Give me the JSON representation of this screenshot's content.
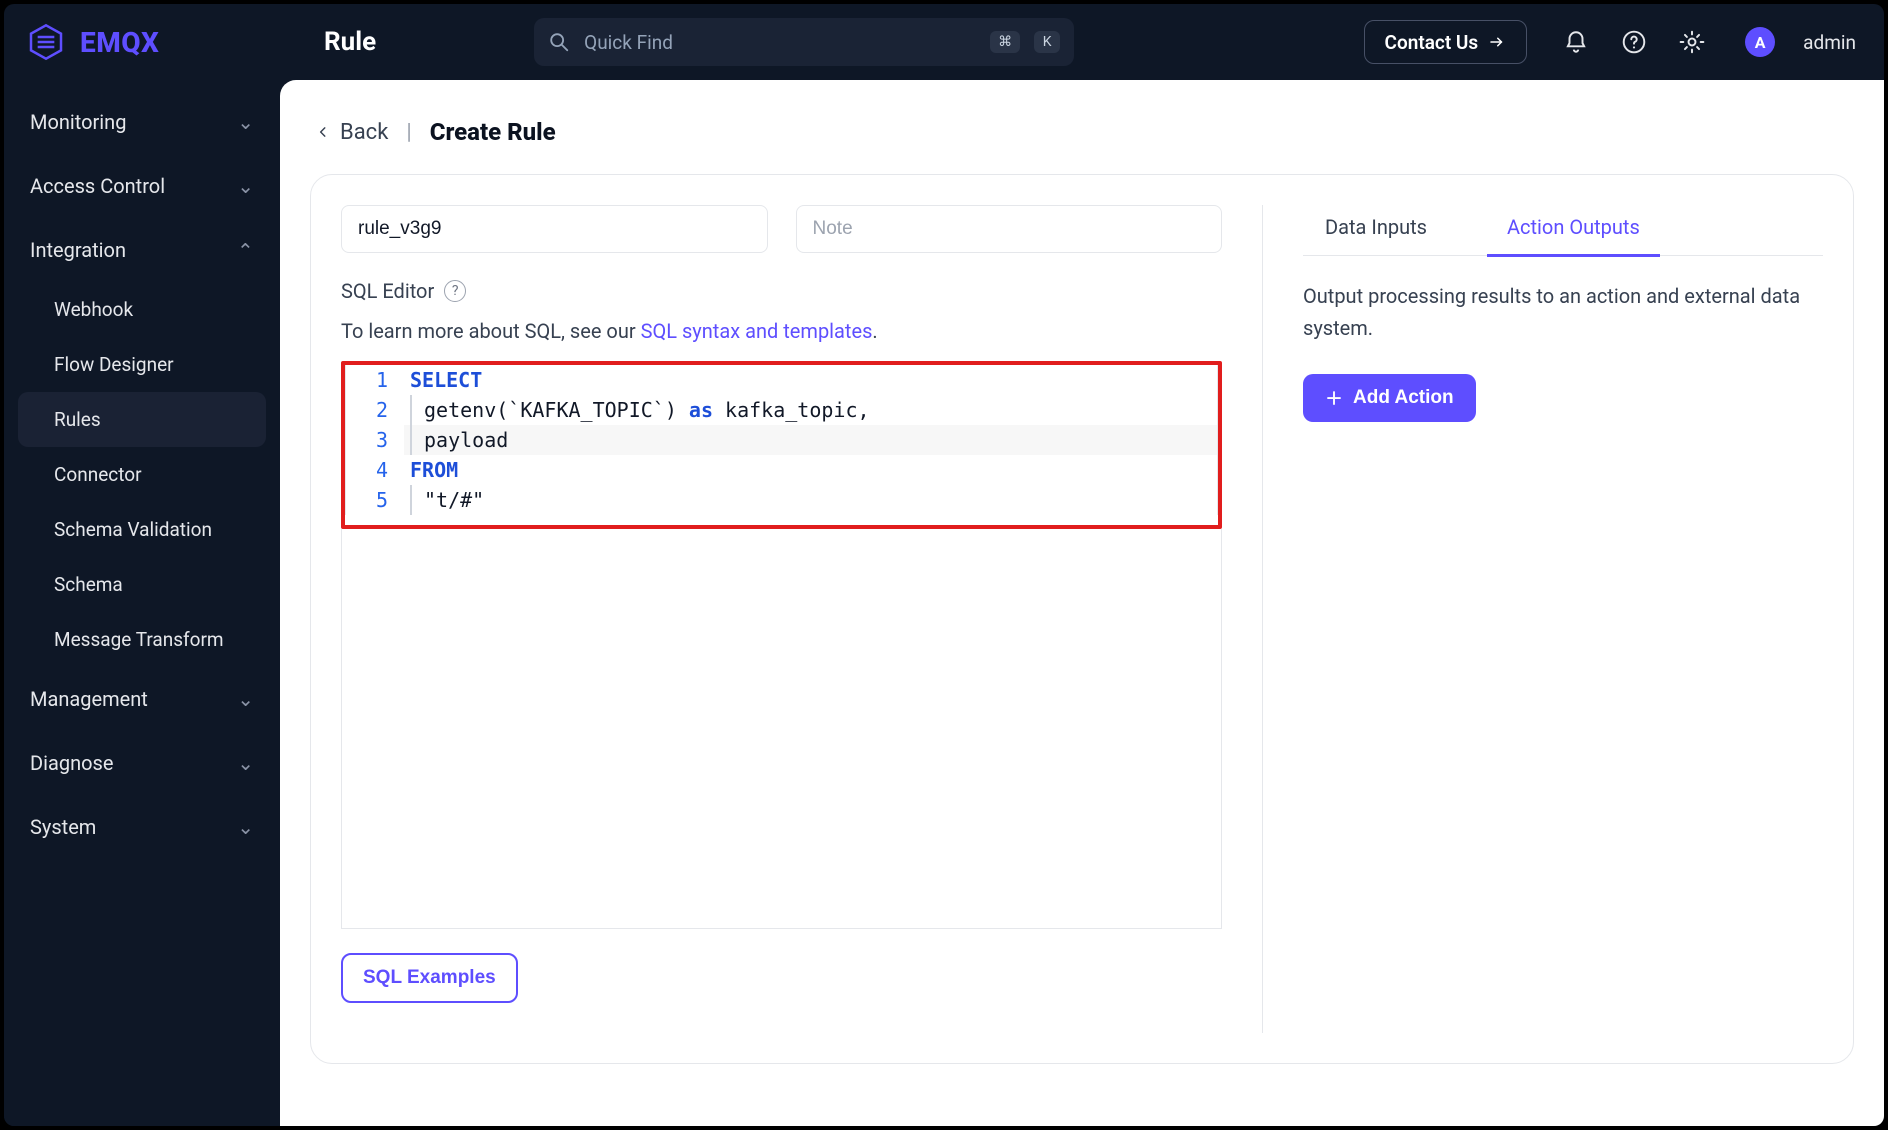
{
  "header": {
    "app_name": "EMQX",
    "section": "Rule",
    "search_placeholder": "Quick Find",
    "shortcut_keys": [
      "⌘",
      "K"
    ],
    "contact_label": "Contact Us",
    "avatar_letter": "A",
    "user_label": "admin"
  },
  "sidenav": {
    "groups": [
      {
        "label": "Monitoring",
        "expanded": false
      },
      {
        "label": "Access Control",
        "expanded": false
      },
      {
        "label": "Integration",
        "expanded": true
      },
      {
        "label": "Management",
        "expanded": false
      },
      {
        "label": "Diagnose",
        "expanded": false
      },
      {
        "label": "System",
        "expanded": false
      }
    ],
    "integration_items": [
      {
        "label": "Webhook",
        "active": false
      },
      {
        "label": "Flow Designer",
        "active": false
      },
      {
        "label": "Rules",
        "active": true
      },
      {
        "label": "Connector",
        "active": false
      },
      {
        "label": "Schema Validation",
        "active": false
      },
      {
        "label": "Schema",
        "active": false
      },
      {
        "label": "Message Transform",
        "active": false
      }
    ]
  },
  "crumbs": {
    "back": "Back",
    "title": "Create Rule"
  },
  "form": {
    "rule_id": "rule_v3g9",
    "note_placeholder": "Note",
    "sql_editor_label": "SQL Editor",
    "sql_hint_prefix": "To learn more about SQL, see our ",
    "sql_hint_link": "SQL syntax and templates",
    "sql_hint_suffix": ".",
    "examples_button": "SQL Examples",
    "code": {
      "l1_select": "SELECT",
      "l2_a": "getenv(`KAFKA_TOPIC`) ",
      "l2_as": "as",
      "l2_b": " kafka_topic,",
      "l3": "payload",
      "l4_from": "FROM",
      "l5": "\"t/#\""
    }
  },
  "right": {
    "tabs": {
      "data_inputs": "Data Inputs",
      "action_outputs": "Action Outputs"
    },
    "desc": "Output processing results to an action and external data system.",
    "add_action": "Add Action"
  }
}
